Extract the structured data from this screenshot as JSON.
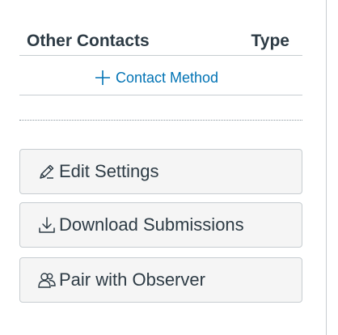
{
  "contacts": {
    "column_other": "Other Contacts",
    "column_type": "Type",
    "add_label": "Contact Method",
    "add_icon": "plus-icon"
  },
  "actions": [
    {
      "label": "Edit Settings",
      "icon": "pencil-icon"
    },
    {
      "label": "Download Submissions",
      "icon": "download-icon"
    },
    {
      "label": "Pair with Observer",
      "icon": "users-icon"
    }
  ],
  "colors": {
    "text": "#2d3b45",
    "link": "#0374b5",
    "button_bg": "#f5f5f5",
    "border": "#c7cdd1"
  }
}
